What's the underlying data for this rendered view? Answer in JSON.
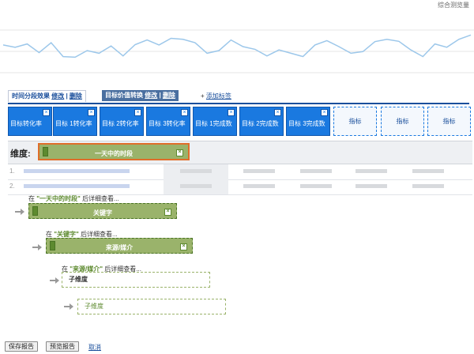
{
  "chart": {
    "title": "综合测览量",
    "line_color": "#9cc7ea",
    "trend": [
      0.55,
      0.48,
      0.58,
      0.32,
      0.62,
      0.2,
      0.18,
      0.38,
      0.3,
      0.52,
      0.22,
      0.56,
      0.7,
      0.55,
      0.75,
      0.72,
      0.62,
      0.3,
      0.38,
      0.7,
      0.5,
      0.42,
      0.22,
      0.4,
      0.3,
      0.2,
      0.55,
      0.68,
      0.5,
      0.3,
      0.35,
      0.65,
      0.72,
      0.66,
      0.4,
      0.2,
      0.58,
      0.48,
      0.72,
      0.85
    ]
  },
  "tabs": {
    "tab1": {
      "label": "时间分段效果",
      "edit": "修改",
      "delete": "删除"
    },
    "tab2": {
      "label": "目标价值转换",
      "edit": "修改",
      "delete": "删除"
    },
    "add_prefix": "+",
    "add_label": "添加标签"
  },
  "metrics": [
    "目标转化率",
    "目标 1转化率",
    "目标 2转化率",
    "目标 3转化率",
    "目标 1完成数",
    "目标 2完成数",
    "目标 3完成数"
  ],
  "metric_placeholders": [
    "指标",
    "指标",
    "指标"
  ],
  "close_glyph": "×",
  "dimension": {
    "label": "维度:",
    "chip": "一天中的时段"
  },
  "rows": [
    {
      "num": "1."
    },
    {
      "num": "2."
    }
  ],
  "drilldown": {
    "level1": {
      "pre": "在",
      "name": "\"一天中的时段\"",
      "post": "后详细查看...",
      "chip": "关键字"
    },
    "level2": {
      "pre": "在",
      "name": "\"关键字\"",
      "post": "后详细查看...",
      "chip": "来源/媒介"
    },
    "level3": {
      "pre": "在",
      "name": "\"来源/媒介\"",
      "post": "后详细查看...",
      "chip": "子维度"
    },
    "level4": {
      "chip": "子维度"
    }
  },
  "buttons": {
    "save": "保存报告",
    "preview": "预览报告",
    "cancel": "取消"
  }
}
